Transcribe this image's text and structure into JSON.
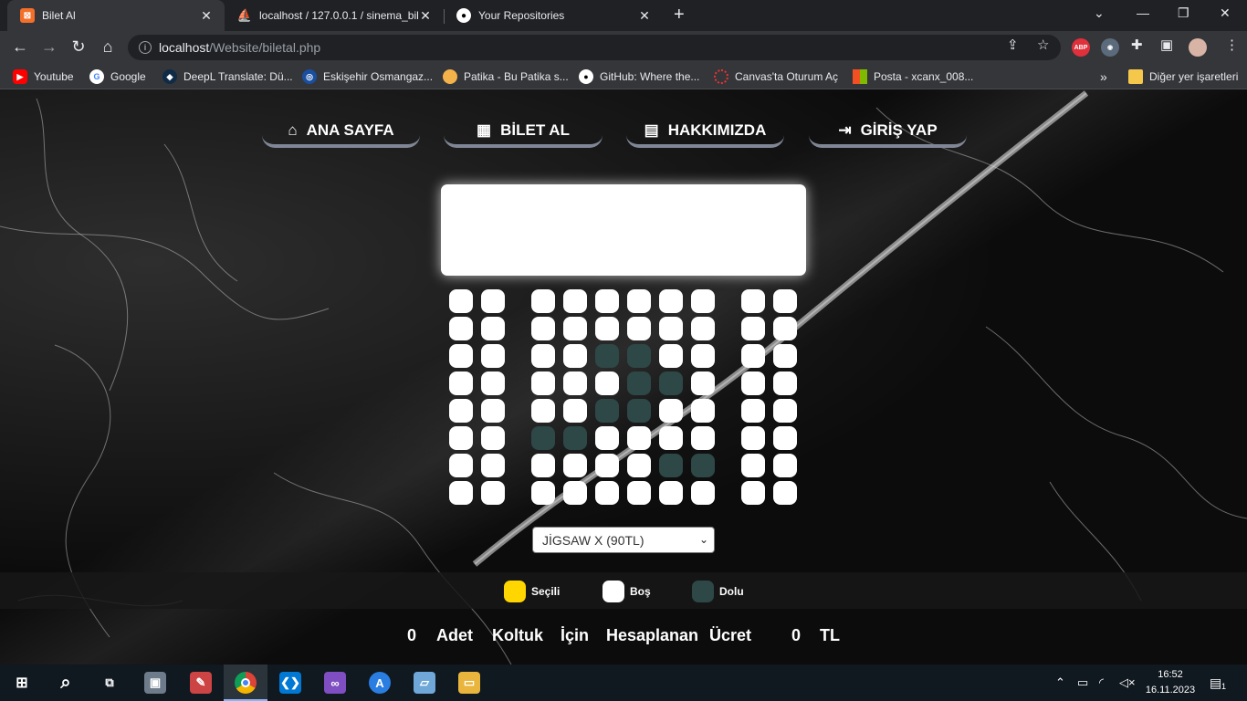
{
  "browser": {
    "tabs": [
      {
        "title": "Bilet Al",
        "active": true
      },
      {
        "title": "localhost / 127.0.0.1 / sinema_bil",
        "active": false
      },
      {
        "title": "Your Repositories",
        "active": false
      }
    ],
    "new_tab_label": "+",
    "url_host": "localhost",
    "url_path": "/Website/biletal.php",
    "bookmarks": [
      "Youtube",
      "Google",
      "DeepL Translate: Dü...",
      "Eskişehir Osmangaz...",
      "Patika - Bu Patika s...",
      "GitHub: Where the...",
      "Canvas'ta Oturum Aç",
      "Posta - xcanx_008..."
    ],
    "bookmarks_overflow": "»",
    "other_bookmarks": "Diğer yer işaretleri",
    "extensions": {
      "adblock": "ABP"
    }
  },
  "nav": {
    "home": "ANA SAYFA",
    "buy": "BİLET AL",
    "about": "HAKKIMIZDA",
    "login": "GİRİŞ YAP"
  },
  "seating": {
    "rows": 8,
    "cols": 12,
    "occupied": [
      [
        2,
        4
      ],
      [
        2,
        5
      ],
      [
        3,
        5
      ],
      [
        3,
        6
      ],
      [
        4,
        4
      ],
      [
        4,
        5
      ],
      [
        5,
        2
      ],
      [
        5,
        3
      ],
      [
        6,
        6
      ],
      [
        6,
        7
      ]
    ],
    "colors": {
      "selected": "#ffd600",
      "empty": "#ffffff",
      "occupied": "#2e4747"
    }
  },
  "movie_select": {
    "value": "JİGSAW X   (90TL)"
  },
  "legend": {
    "selected": "Seçili",
    "empty": "Boş",
    "occupied": "Dolu"
  },
  "summary": {
    "count": "0",
    "w1": "Adet",
    "w2": "Koltuk",
    "w3": "İçin",
    "w4": "Hesaplanan",
    "w5": "Ücret",
    "price": "0",
    "currency": "TL"
  },
  "taskbar": {
    "time": "16:52",
    "date": "16.11.2023",
    "notifications": "1"
  }
}
